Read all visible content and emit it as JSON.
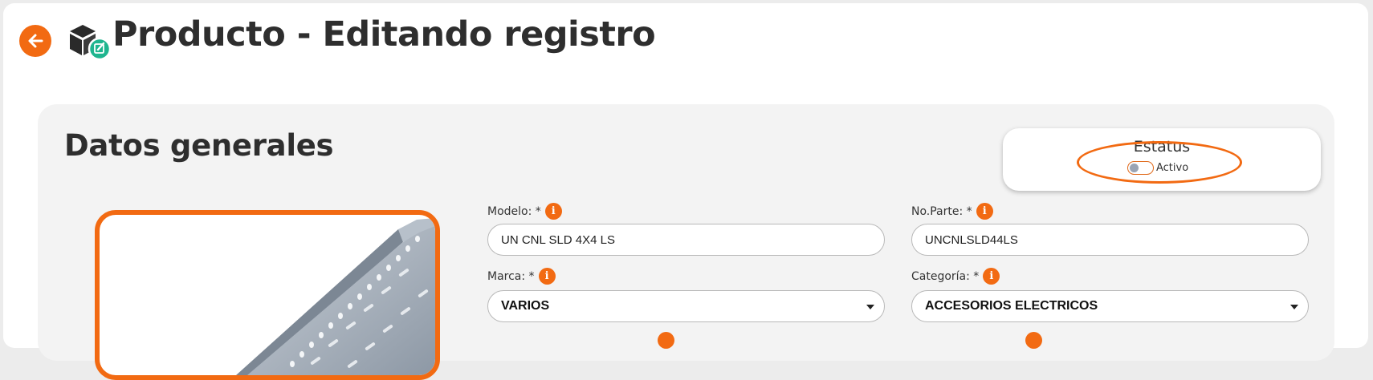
{
  "header": {
    "title": "Producto - Editando registro",
    "back_icon": "arrow-left-icon",
    "product_icon": "box-edit-icon"
  },
  "section": {
    "title": "Datos generales"
  },
  "status": {
    "label": "Estatus",
    "toggle_label": "Activo",
    "active": false
  },
  "form": {
    "modelo": {
      "label": "Modelo: *",
      "value": "UN CNL SLD 4X4 LS"
    },
    "no_parte": {
      "label": "No.Parte: *",
      "value": "UNCNLSLD44LS"
    },
    "marca": {
      "label": "Marca: *",
      "value": "VARIOS"
    },
    "categoria": {
      "label": "Categoría: *",
      "value": "ACCESORIOS ELECTRICOS"
    },
    "info_symbol": "i"
  },
  "colors": {
    "accent": "#f26a12",
    "edit_badge": "#1fb58f",
    "card_bg": "#f3f3f3",
    "title_text": "#2e2e2e"
  }
}
